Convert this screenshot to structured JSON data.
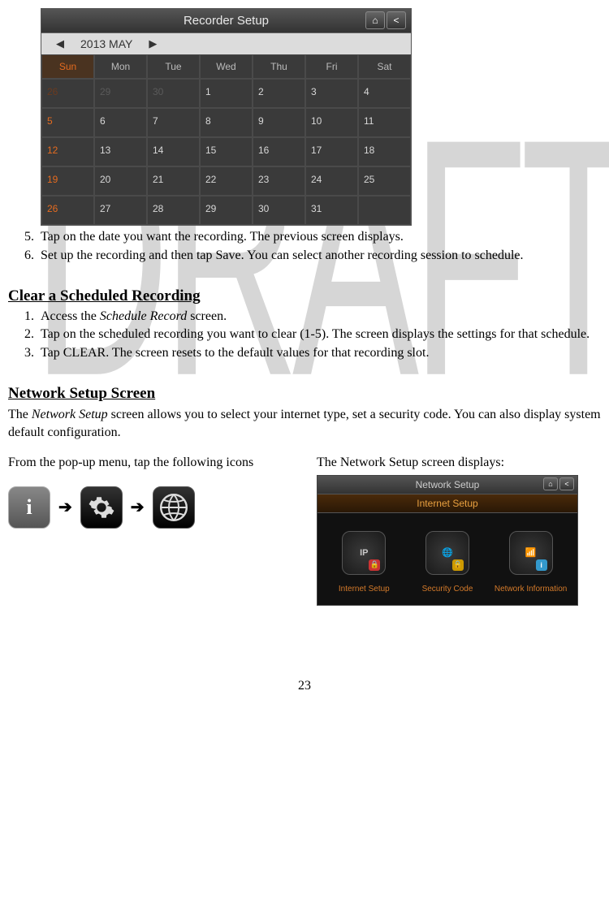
{
  "watermark": "DRAFT",
  "calendar": {
    "title": "Recorder Setup",
    "month_label": "2013 MAY",
    "headers": [
      "Sun",
      "Mon",
      "Tue",
      "Wed",
      "Thu",
      "Fri",
      "Sat"
    ],
    "rows": [
      [
        {
          "v": "26",
          "sun": true,
          "prev": true
        },
        {
          "v": "29",
          "prev": true
        },
        {
          "v": "30",
          "prev": true
        },
        {
          "v": "1"
        },
        {
          "v": "2"
        },
        {
          "v": "3"
        },
        {
          "v": "4"
        }
      ],
      [
        {
          "v": "5",
          "sun": true
        },
        {
          "v": "6"
        },
        {
          "v": "7"
        },
        {
          "v": "8"
        },
        {
          "v": "9"
        },
        {
          "v": "10"
        },
        {
          "v": "11"
        }
      ],
      [
        {
          "v": "12",
          "sun": true
        },
        {
          "v": "13"
        },
        {
          "v": "14"
        },
        {
          "v": "15"
        },
        {
          "v": "16"
        },
        {
          "v": "17"
        },
        {
          "v": "18"
        }
      ],
      [
        {
          "v": "19",
          "sun": true
        },
        {
          "v": "20"
        },
        {
          "v": "21"
        },
        {
          "v": "22"
        },
        {
          "v": "23"
        },
        {
          "v": "24"
        },
        {
          "v": "25"
        }
      ],
      [
        {
          "v": "26",
          "sun": true
        },
        {
          "v": "27"
        },
        {
          "v": "28"
        },
        {
          "v": "29"
        },
        {
          "v": "30"
        },
        {
          "v": "31"
        },
        {
          "v": ""
        }
      ]
    ]
  },
  "steps_a": {
    "start": 5,
    "items": [
      "Tap on the date you want the recording. The previous screen displays.",
      "Set up the recording and then tap Save. You can select another recording session to schedule."
    ]
  },
  "section_clear": {
    "heading": "Clear a Scheduled Recording",
    "items": [
      {
        "pre": "Access the ",
        "em": "Schedule Record",
        "post": " screen."
      },
      {
        "pre": "Tap on the scheduled recording you want to clear (1-5). The screen displays the settings for that schedule.",
        "em": "",
        "post": ""
      },
      {
        "pre": "Tap CLEAR. The screen resets to the default values for that recording slot.",
        "em": "",
        "post": ""
      }
    ]
  },
  "section_net": {
    "heading": "Network Setup Screen",
    "intro_pre": "The ",
    "intro_em": "Network Setup",
    "intro_post": " screen allows you to select your internet type, set a security code. You can also display system default configuration.",
    "left_label": "From the pop-up menu, tap the following icons",
    "right_label": "The Network Setup screen displays:"
  },
  "netsetup": {
    "title": "Network Setup",
    "subtitle": "Internet Setup",
    "items": [
      "Internet Setup",
      "Security Code",
      "Network Information"
    ],
    "icon_text": [
      "IP",
      "",
      ""
    ]
  },
  "icons": {
    "arrow": "➔"
  },
  "page_number": "23"
}
